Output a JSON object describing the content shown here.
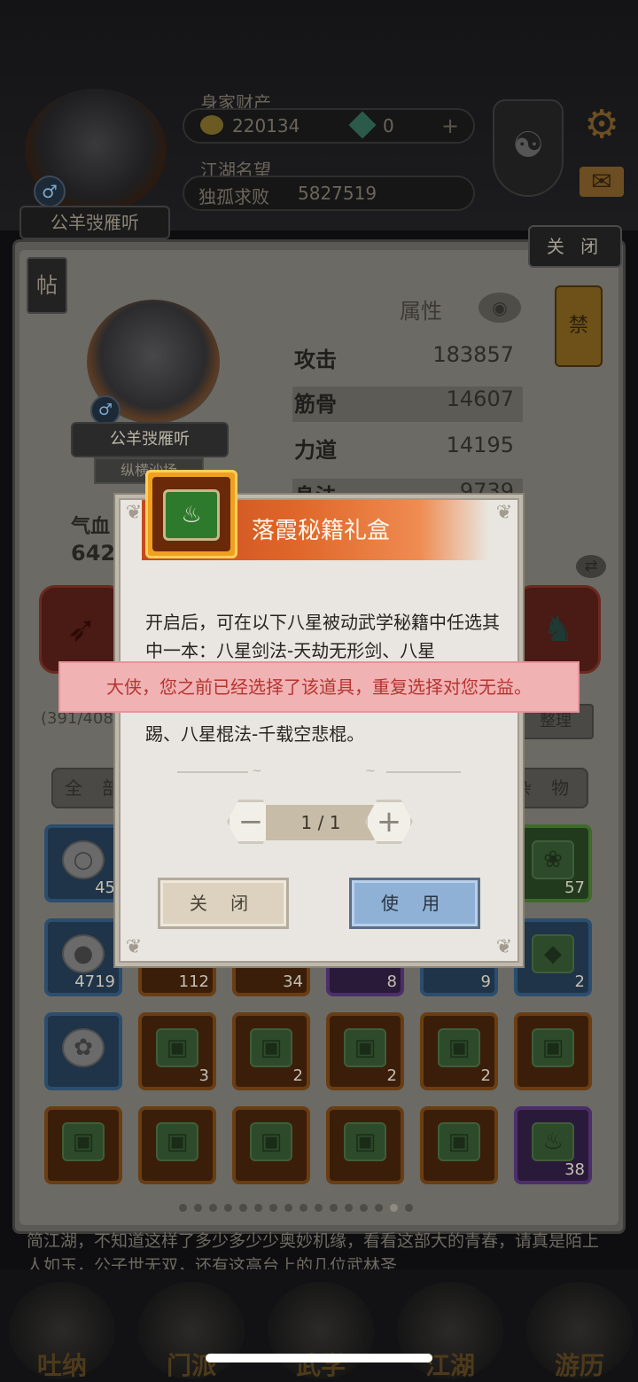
{
  "header": {
    "player_name": "公羊弢雁听",
    "gender_symbol": "♂",
    "wealth_label": "身家财产",
    "gold": "220134",
    "jade": "0",
    "plus": "+",
    "fame_label": "江湖名望",
    "fame_title": "独孤求败",
    "fame_value": "5827519",
    "taiji_symbol": "☯",
    "gear_symbol": "⚙",
    "mail_symbol": "✉"
  },
  "panel": {
    "close_label": "关 闭",
    "tie_label": "帖",
    "hero_name": "公羊弢雁听",
    "hero_sub": "纵横沙场",
    "qixue_label": "气血",
    "qixue_value": "642",
    "attr_header": "属性",
    "eye_symbol": "◉",
    "banner_symbol": "禁",
    "swap_symbol": "⇄",
    "attributes": [
      {
        "name": "攻击",
        "value": "183857"
      },
      {
        "name": "筋骨",
        "value": "14607"
      },
      {
        "name": "力道",
        "value": "14195"
      },
      {
        "name": "身法",
        "value": "9739"
      }
    ],
    "slot_count": "(391/408",
    "tidy_label": "整理",
    "tab_all": "全 部",
    "tab_misc": "杂 物"
  },
  "inventory": [
    [
      {
        "c": "45",
        "t": "blue",
        "i": "○"
      },
      {
        "c": "",
        "t": "blue",
        "i": ""
      },
      {
        "c": "",
        "t": "blue",
        "i": ""
      },
      {
        "c": "",
        "t": "blue",
        "i": ""
      },
      {
        "c": "",
        "t": "blue",
        "i": ""
      },
      {
        "c": "57",
        "t": "green",
        "i": "❀"
      }
    ],
    [
      {
        "c": "4719",
        "t": "blue",
        "i": "●"
      },
      {
        "c": "112",
        "t": "orange",
        "i": ""
      },
      {
        "c": "34",
        "t": "orange",
        "i": ""
      },
      {
        "c": "8",
        "t": "purple",
        "i": ""
      },
      {
        "c": "9",
        "t": "blue",
        "i": ""
      },
      {
        "c": "2",
        "t": "blue",
        "i": "◆"
      }
    ],
    [
      {
        "c": "",
        "t": "blue",
        "i": "✿"
      },
      {
        "c": "3",
        "t": "orange",
        "i": "▣"
      },
      {
        "c": "2",
        "t": "orange",
        "i": "▣"
      },
      {
        "c": "2",
        "t": "orange",
        "i": "▣"
      },
      {
        "c": "2",
        "t": "orange",
        "i": "▣"
      },
      {
        "c": "",
        "t": "orange",
        "i": "▣"
      }
    ],
    [
      {
        "c": "",
        "t": "orange",
        "i": "▣"
      },
      {
        "c": "",
        "t": "orange",
        "i": "▣"
      },
      {
        "c": "",
        "t": "orange",
        "i": "▣"
      },
      {
        "c": "",
        "t": "orange",
        "i": "▣"
      },
      {
        "c": "",
        "t": "orange",
        "i": "▣"
      },
      {
        "c": "38",
        "t": "purple",
        "i": "♨"
      }
    ]
  ],
  "story_text": "简江湖，不知道这样了多少多少少奥妙机缘，看看这部大的青春，请真是陌上人如玉，公子世无双，还有这高台上的几位武林圣",
  "nav": [
    "吐纳",
    "门派",
    "武学",
    "江湖",
    "游历"
  ],
  "dialog": {
    "title": "落霞秘籍礼盒",
    "chest_symbol": "♨",
    "description": "开启后，可在以下八星被动武学秘籍中任选其中一本：八星剑法-天劫无形剑、八星",
    "description_end": "踢、八星棍法-千载空悲棍。",
    "minus": "−",
    "plus": "+",
    "quantity": "1 / 1",
    "close_label": "关 闭",
    "use_label": "使 用"
  },
  "toast": {
    "message": "大侠，您之前已经选择了该道具，重复选择对您无益。"
  },
  "pagination": {
    "total": 16,
    "active": 15
  }
}
